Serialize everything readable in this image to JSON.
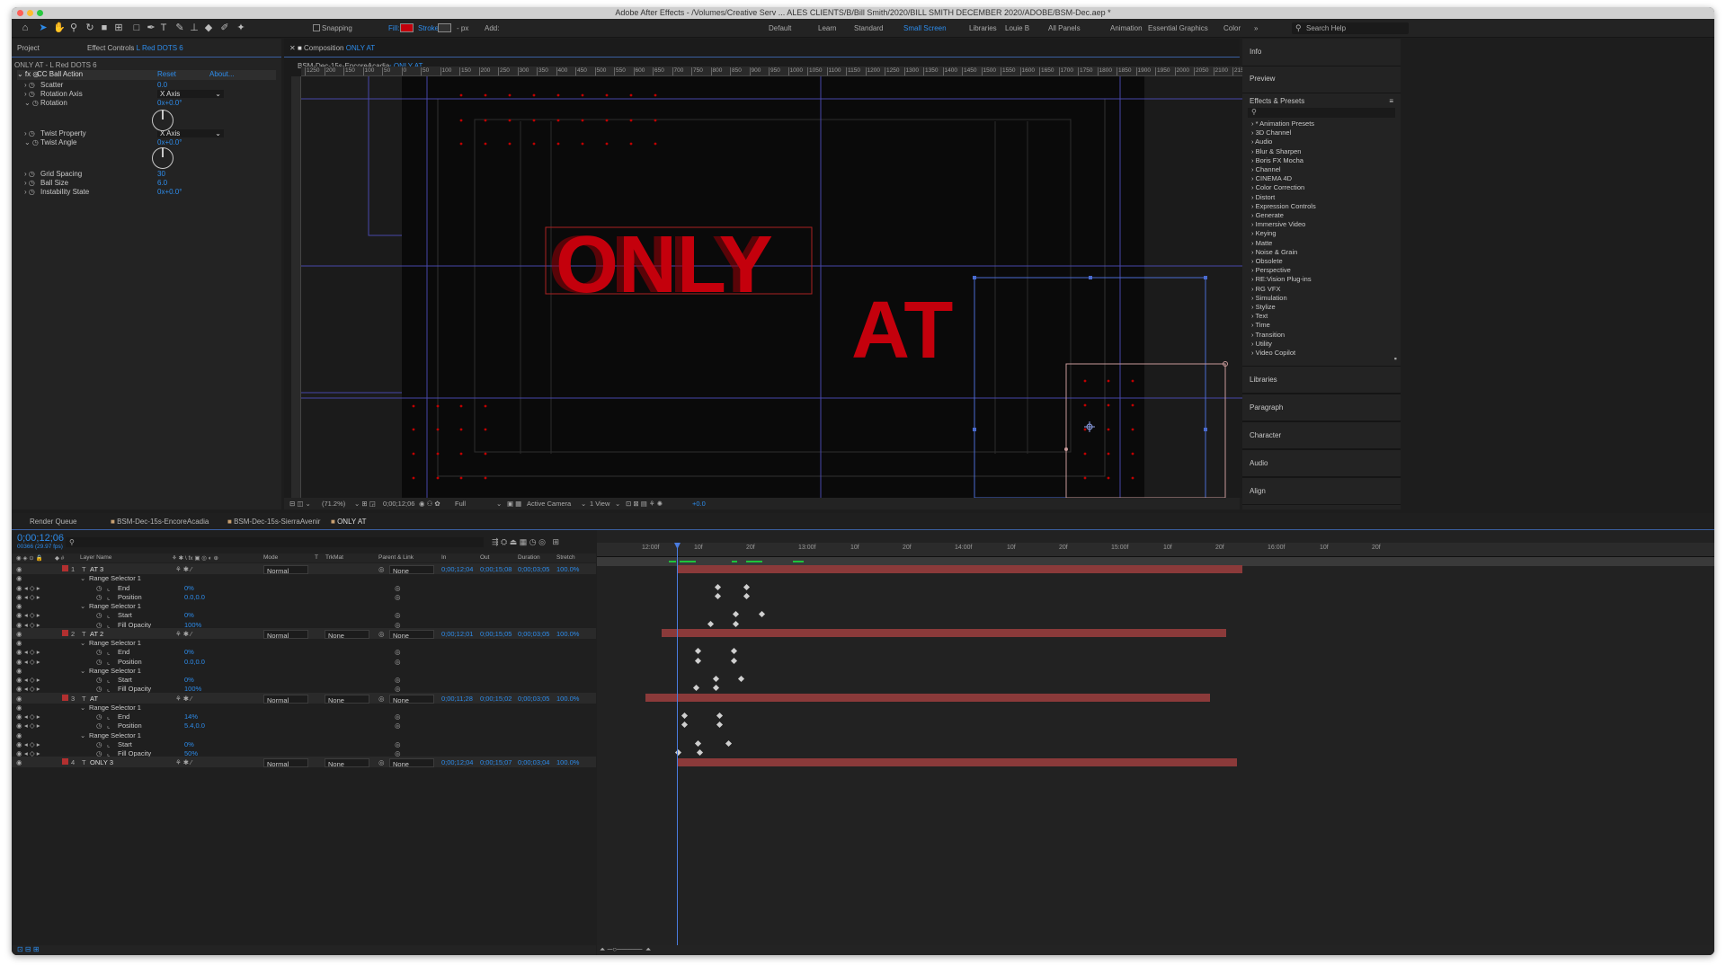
{
  "app": {
    "window_title": "Adobe After Effects - /Volumes/Creative Serv ... ALES CLIENTS/B/Bill Smith/2020/BILL SMITH DECEMBER 2020/ADOBE/BSM-Dec.aep *"
  },
  "toolbar": {
    "snapping": "Snapping",
    "fill": "Fill:",
    "stroke": "Stroke:",
    "px": "- px",
    "add": "Add:",
    "workspaces": [
      "Default",
      "Learn",
      "Standard",
      "Small Screen",
      "Libraries",
      "Louie B",
      "All Panels",
      "Animation",
      "Essential Graphics",
      "Color"
    ],
    "active_workspace": "Small Screen",
    "search_placeholder": "Search Help"
  },
  "effect_panel": {
    "tab_project": "Project",
    "tab_effect": "Effect Controls",
    "tab_effect_layer": "L Red DOTS 6",
    "layer_path": "ONLY AT - L Red DOTS 6",
    "effect_name": "CC Ball Action",
    "reset": "Reset",
    "about": "About...",
    "props": [
      {
        "name": "Scatter",
        "value": "0.0"
      },
      {
        "name": "Rotation Axis",
        "value": "X Axis"
      },
      {
        "name": "Rotation",
        "value": "0x+0.0°"
      },
      {
        "name": "Twist Property",
        "value": "X Axis"
      },
      {
        "name": "Twist Angle",
        "value": "0x+0.0°"
      },
      {
        "name": "Grid Spacing",
        "value": "30"
      },
      {
        "name": "Ball Size",
        "value": "6.0"
      },
      {
        "name": "Instability State",
        "value": "0x+0.0°"
      }
    ]
  },
  "comp_panel": {
    "tab_label": "Composition",
    "comp_name": "ONLY AT",
    "breadcrumbs": [
      "BSM-Dec-15s-EncoreAcadia",
      "ONLY AT"
    ],
    "ruler_ticks": [
      "1250",
      "200",
      "150",
      "100",
      "50",
      "0",
      "50",
      "100",
      "150",
      "200",
      "250",
      "300",
      "350",
      "400",
      "450",
      "500",
      "550",
      "600",
      "650",
      "700",
      "750",
      "800",
      "850",
      "900",
      "950",
      "1000",
      "1050",
      "1100",
      "1150",
      "1200",
      "1250",
      "1300",
      "1350",
      "1400",
      "1450",
      "1500",
      "1550",
      "1600",
      "1650",
      "1700",
      "1750",
      "1800",
      "1850",
      "1900",
      "1950",
      "2000",
      "2050",
      "2100",
      "2150"
    ],
    "text_only": "ONLY",
    "text_at": "AT",
    "zoom": "(71.2%)",
    "timecode": "0;00;12;06",
    "resolution": "Full",
    "camera": "Active Camera",
    "view": "1 View",
    "exposure": "+0.0"
  },
  "right_panels": {
    "top": [
      "Info",
      "Preview"
    ],
    "effects_presets": "Effects & Presets",
    "effects_list": [
      "* Animation Presets",
      "3D Channel",
      "Audio",
      "Blur & Sharpen",
      "Boris FX Mocha",
      "Channel",
      "CINEMA 4D",
      "Color Correction",
      "Distort",
      "Expression Controls",
      "Generate",
      "Immersive Video",
      "Keying",
      "Matte",
      "Noise & Grain",
      "Obsolete",
      "Perspective",
      "RE:Vision Plug-ins",
      "RG VFX",
      "Simulation",
      "Stylize",
      "Text",
      "Time",
      "Transition",
      "Utility",
      "Video Copilot"
    ],
    "bottom": [
      "Libraries",
      "Paragraph",
      "Character",
      "Audio",
      "Align"
    ]
  },
  "timeline": {
    "tabs": [
      "Render Queue",
      "BSM-Dec-15s-EncoreAcadia",
      "BSM-Dec-15s-SierraAvenir",
      "ONLY AT"
    ],
    "timecode": "0;00;12;06",
    "frames": "00366 (29.97 fps)",
    "columns": {
      "layer_name": "Layer Name",
      "mode": "Mode",
      "t": "T",
      "trkmat": "TrkMat",
      "parent": "Parent & Link",
      "in": "In",
      "out": "Out",
      "duration": "Duration",
      "stretch": "Stretch"
    },
    "ruler": [
      "12:00f",
      "10f",
      "20f",
      "13:00f",
      "10f",
      "20f",
      "14:00f",
      "10f",
      "20f",
      "15:00f",
      "10f",
      "20f",
      "16:00f",
      "10f",
      "20f"
    ],
    "rows": [
      {
        "kind": "layer",
        "num": "1",
        "name": "AT 3",
        "mode": "Normal",
        "trkmat": "",
        "parent": "None",
        "in": "0;00;12;04",
        "out": "0;00;15;08",
        "dur": "0;00;03;05",
        "stretch": "100.0%"
      },
      {
        "kind": "sel",
        "name": "Range Selector 1"
      },
      {
        "kind": "prop",
        "name": "End",
        "value": "0%"
      },
      {
        "kind": "prop",
        "name": "Position",
        "value": "0.0,0.0"
      },
      {
        "kind": "sel",
        "name": "Range Selector 1"
      },
      {
        "kind": "prop",
        "name": "Start",
        "value": "0%"
      },
      {
        "kind": "prop",
        "name": "Fill Opacity",
        "value": "100%"
      },
      {
        "kind": "layer",
        "num": "2",
        "name": "AT 2",
        "mode": "Normal",
        "trkmat": "None",
        "parent": "None",
        "in": "0;00;12;01",
        "out": "0;00;15;05",
        "dur": "0;00;03;05",
        "stretch": "100.0%"
      },
      {
        "kind": "sel",
        "name": "Range Selector 1"
      },
      {
        "kind": "prop",
        "name": "End",
        "value": "0%"
      },
      {
        "kind": "prop",
        "name": "Position",
        "value": "0.0,0.0"
      },
      {
        "kind": "sel",
        "name": "Range Selector 1"
      },
      {
        "kind": "prop",
        "name": "Start",
        "value": "0%"
      },
      {
        "kind": "prop",
        "name": "Fill Opacity",
        "value": "100%"
      },
      {
        "kind": "layer",
        "num": "3",
        "name": "AT",
        "mode": "Normal",
        "trkmat": "None",
        "parent": "None",
        "in": "0;00;11;28",
        "out": "0;00;15;02",
        "dur": "0;00;03;05",
        "stretch": "100.0%"
      },
      {
        "kind": "sel",
        "name": "Range Selector 1"
      },
      {
        "kind": "prop",
        "name": "End",
        "value": "14%"
      },
      {
        "kind": "prop",
        "name": "Position",
        "value": "5.4,0.0"
      },
      {
        "kind": "sel",
        "name": "Range Selector 1"
      },
      {
        "kind": "prop",
        "name": "Start",
        "value": "0%"
      },
      {
        "kind": "prop",
        "name": "Fill Opacity",
        "value": "50%"
      },
      {
        "kind": "layer",
        "num": "4",
        "name": "ONLY 3",
        "mode": "Normal",
        "trkmat": "None",
        "parent": "None",
        "in": "0;00;12;04",
        "out": "0;00;15;07",
        "dur": "0;00;03;04",
        "stretch": "100.0%"
      }
    ]
  },
  "colors": {
    "accent": "#2d8ceb",
    "text_red": "#c4000c",
    "bar": "#8b3a3a",
    "guide": "#4747a8"
  }
}
